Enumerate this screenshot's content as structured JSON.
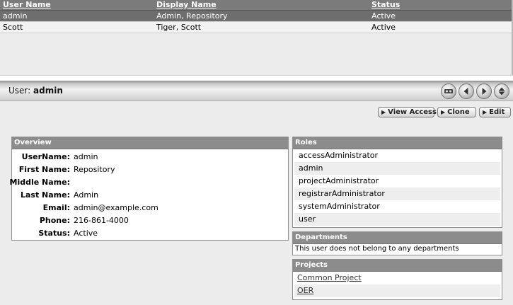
{
  "table": {
    "headers": [
      "User Name",
      "Display Name",
      "Status"
    ],
    "rows": [
      {
        "user_name": "admin",
        "display_name": "Admin, Repository",
        "status": "Active",
        "selected": true
      },
      {
        "user_name": "Scott",
        "display_name": "Tiger, Scott",
        "status": "Active",
        "selected": false
      }
    ]
  },
  "titlebar": {
    "prefix": "User:",
    "user": "admin",
    "nav_icons": [
      "tape-icon",
      "previous-icon",
      "next-icon",
      "collapse-icon"
    ]
  },
  "actions": {
    "view_access": "View Access",
    "clone": "Clone",
    "edit": "Edit"
  },
  "overview": {
    "title": "Overview",
    "fields": [
      {
        "label": "UserName:",
        "value": "admin"
      },
      {
        "label": "First Name:",
        "value": "Repository"
      },
      {
        "label": "Middle Name:",
        "value": ""
      },
      {
        "label": "Last Name:",
        "value": "Admin"
      },
      {
        "label": "Email:",
        "value": "admin@example.com"
      },
      {
        "label": "Phone:",
        "value": "216-861-4000"
      },
      {
        "label": "Status:",
        "value": "Active"
      }
    ]
  },
  "roles": {
    "title": "Roles",
    "items": [
      "accessAdministrator",
      "admin",
      "projectAdministrator",
      "registrarAdministrator",
      "systemAdministrator",
      "user"
    ]
  },
  "departments": {
    "title": "Departments",
    "text": "This user does not belong to any departments"
  },
  "projects": {
    "title": "Projects",
    "items": [
      "Common Project",
      "OER"
    ]
  },
  "colors": {
    "header_gray": "#7b7b7b",
    "selected_row": "#6e6e6e",
    "panel_header": "#8c8c8c",
    "background": "#ececec"
  }
}
